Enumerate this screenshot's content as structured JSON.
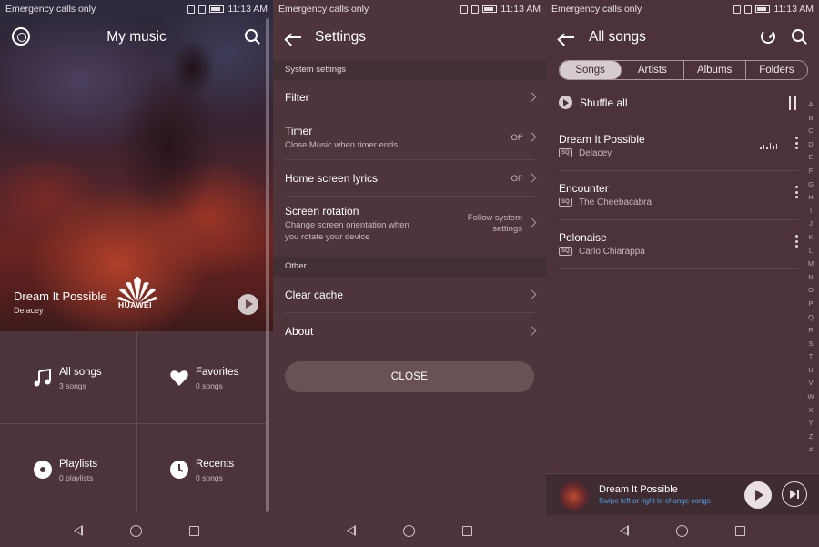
{
  "status_bar": {
    "carrier": "Emergency calls only",
    "time": "11:13 AM"
  },
  "my_music": {
    "title": "My music",
    "now_playing": {
      "track": "Dream It Possible",
      "artist": "Delacey"
    },
    "brand": "HUAWEI",
    "tiles": [
      {
        "label": "All songs",
        "count": "3 songs",
        "icon": "music-note-icon"
      },
      {
        "label": "Favorites",
        "count": "0 songs",
        "icon": "heart-icon"
      },
      {
        "label": "Playlists",
        "count": "0 playlists",
        "icon": "disc-icon"
      },
      {
        "label": "Recents",
        "count": "0 songs",
        "icon": "clock-icon"
      }
    ]
  },
  "settings": {
    "title": "Settings",
    "section_system": "System settings",
    "filter": "Filter",
    "timer": {
      "label": "Timer",
      "desc": "Close Music when timer ends",
      "value": "Off"
    },
    "lyrics": {
      "label": "Home screen lyrics",
      "value": "Off"
    },
    "rotation": {
      "label": "Screen rotation",
      "desc_line1": "Change screen orientation when",
      "desc_line2": "you rotate your device",
      "value_line1": "Follow system",
      "value_line2": "settings"
    },
    "section_other": "Other",
    "clear_cache": "Clear cache",
    "about": "About",
    "close": "CLOSE"
  },
  "all_songs": {
    "title": "All songs",
    "tabs": [
      "Songs",
      "Artists",
      "Albums",
      "Folders"
    ],
    "active_tab": "Songs",
    "shuffle": "Shuffle all",
    "quality_badge": "SQ",
    "songs": [
      {
        "title": "Dream It Possible",
        "artist": "Delacey",
        "playing": true
      },
      {
        "title": "Encounter",
        "artist": "The Cheebacabra",
        "playing": false
      },
      {
        "title": "Polonaise",
        "artist": "Carlo Chiarappa",
        "playing": false
      }
    ],
    "index_letters": [
      "A",
      "B",
      "C",
      "D",
      "E",
      "F",
      "G",
      "H",
      "I",
      "J",
      "K",
      "L",
      "M",
      "N",
      "O",
      "P",
      "Q",
      "R",
      "S",
      "T",
      "U",
      "V",
      "W",
      "X",
      "Y",
      "Z",
      "#"
    ],
    "mini_player": {
      "title": "Dream It Possible",
      "hint": "Swipe left or right to change songs",
      "hint_color": "#4fa0e8"
    }
  }
}
